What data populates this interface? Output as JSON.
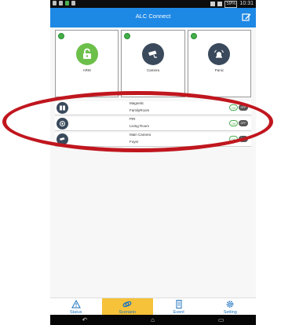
{
  "statusbar": {
    "time": "10:31",
    "battery": "59%"
  },
  "header": {
    "title": "ALC Connect"
  },
  "tiles": [
    {
      "label": "ARM",
      "icon": "unlocked-padlock-icon",
      "color": "#6cc04a"
    },
    {
      "label": "Camera",
      "icon": "security-camera-icon",
      "color": "#3a4a5c"
    },
    {
      "label": "Panic",
      "icon": "panic-alarm-icon",
      "color": "#3a4a5c"
    }
  ],
  "devices": [
    {
      "name": "Magnetic",
      "room": "FamilyRoom",
      "icon": "magnetic-sensor-icon",
      "on_label": "ON",
      "off_label": "OFF"
    },
    {
      "name": "PIR",
      "room": "Living Room",
      "icon": "motion-sensor-icon",
      "on_label": "ON",
      "off_label": "OFF"
    },
    {
      "name": "Main Camera",
      "room": "Foyer",
      "icon": "camera-icon",
      "on_label": "ON",
      "off_label": "OFF"
    }
  ],
  "nav": {
    "status": "Status",
    "scenario": "Scenario",
    "event": "Event",
    "setting": "Setting"
  },
  "colors": {
    "accent": "#1e88e5",
    "active_tab": "#f6c23a",
    "highlight_oval": "#c0161e",
    "on_green": "#4caf50"
  }
}
